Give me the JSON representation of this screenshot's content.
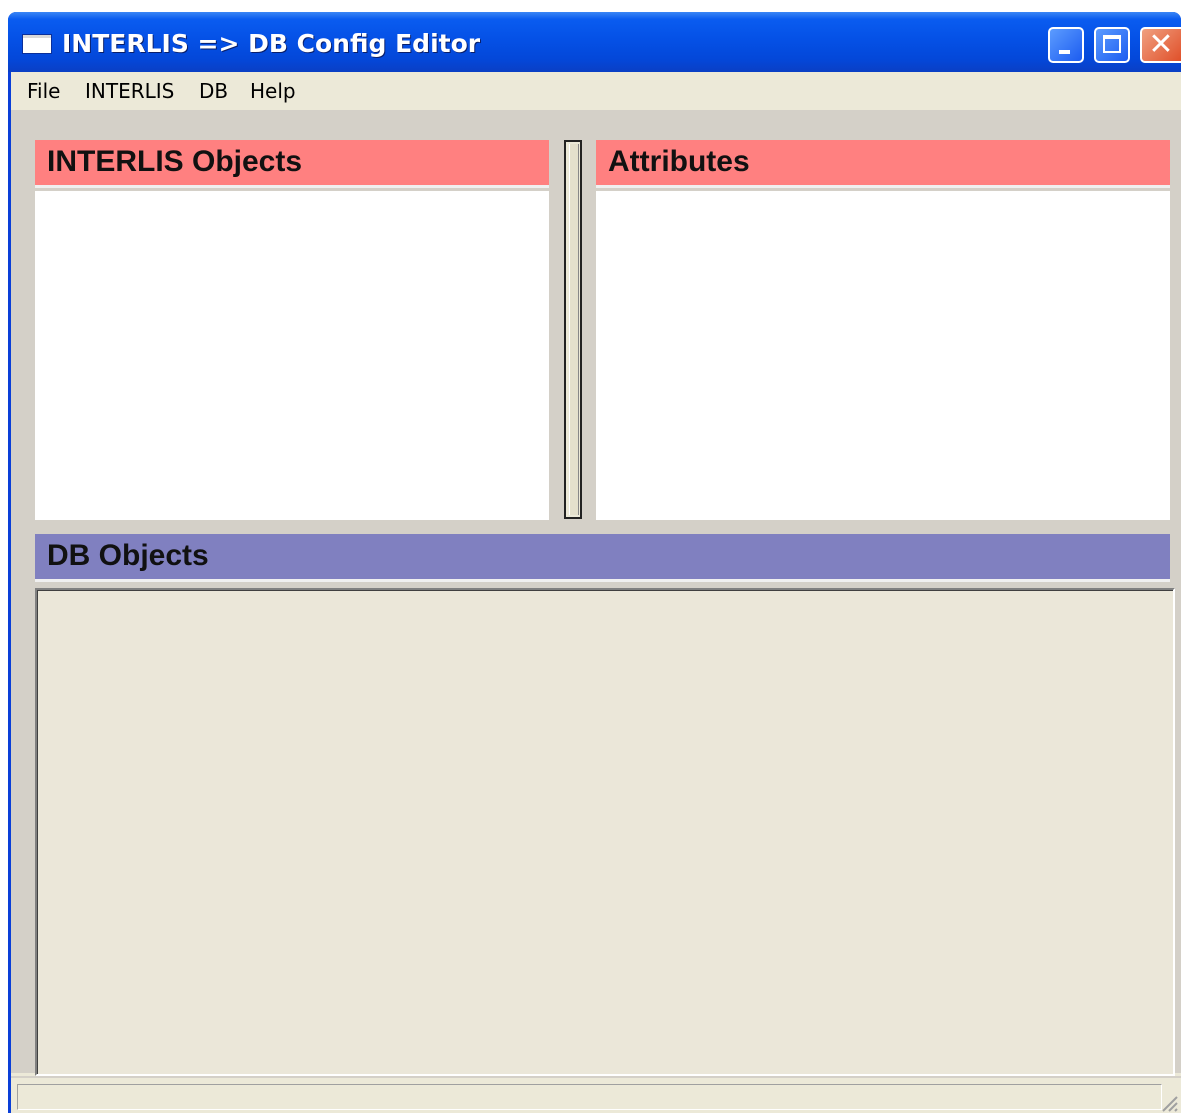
{
  "window": {
    "title": "INTERLIS => DB Config Editor",
    "controls": {
      "minimize_icon": "minimize-icon",
      "maximize_icon": "maximize-icon",
      "close_icon": "close-icon",
      "close_glyph": "✕"
    }
  },
  "menubar": {
    "items": [
      {
        "label": "File"
      },
      {
        "label": "INTERLIS"
      },
      {
        "label": "DB"
      },
      {
        "label": "Help"
      }
    ]
  },
  "panels": {
    "interlis_objects": {
      "title": "INTERLIS Objects",
      "items": []
    },
    "attributes": {
      "title": "Attributes",
      "items": []
    },
    "db_objects": {
      "title": "DB Objects",
      "items": []
    }
  },
  "statusbar": {
    "text": ""
  },
  "colors": {
    "titlebar": "#0551e6",
    "panel_header_red": "#ff8080",
    "panel_header_blue": "#8080c0",
    "window_face": "#ece9d8"
  }
}
